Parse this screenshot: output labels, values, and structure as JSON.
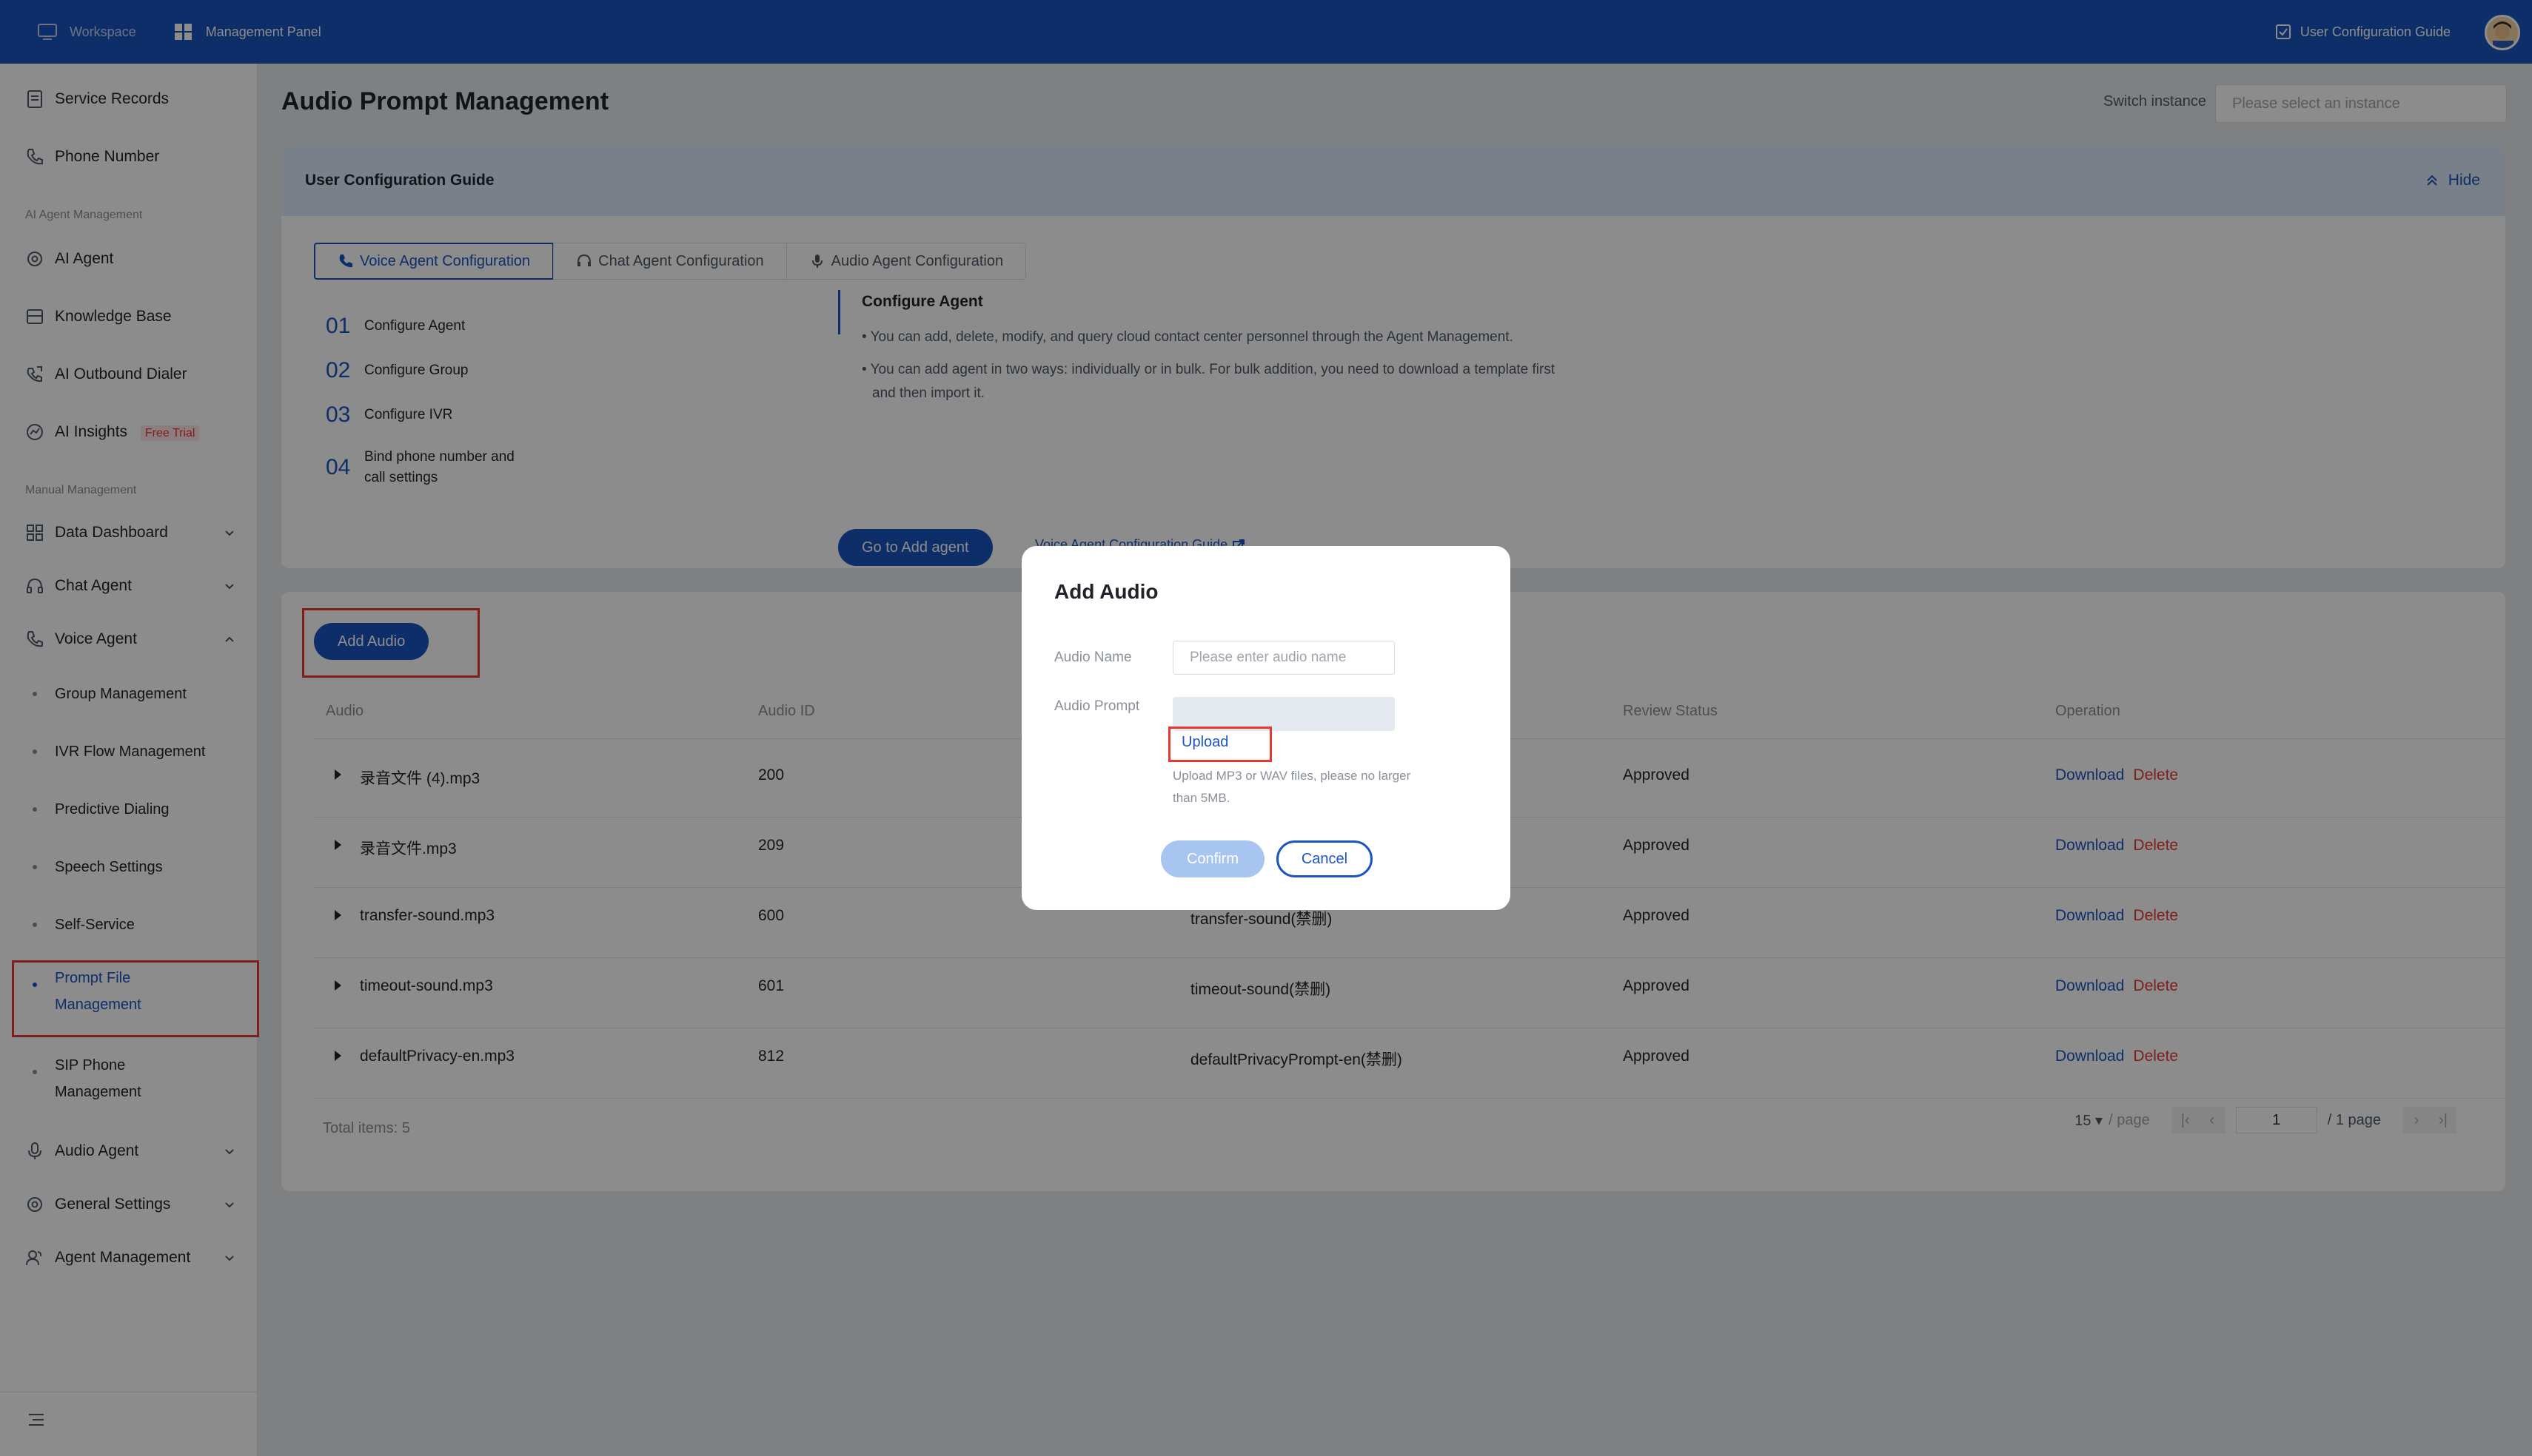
{
  "topbar": {
    "workspace": "Workspace",
    "management_panel": "Management Panel",
    "user_guide": "User Configuration Guide"
  },
  "sidebar": {
    "service_records": "Service Records",
    "phone_number": "Phone Number",
    "section_ai": "AI Agent Management",
    "ai_agent": "AI Agent",
    "knowledge_base": "Knowledge Base",
    "ai_outbound_dialer": "AI Outbound Dialer",
    "ai_insights": "AI Insights",
    "ai_insights_badge": "Free Trial",
    "section_manual": "Manual Management",
    "data_dashboard": "Data Dashboard",
    "chat_agent": "Chat Agent",
    "voice_agent": "Voice Agent",
    "voice_sub": [
      "Group Management",
      "IVR Flow Management",
      "Predictive Dialing",
      "Speech Settings",
      "Self-Service"
    ],
    "prompt_file_mgmt_1": "Prompt File",
    "prompt_file_mgmt_2": "Management",
    "sip_phone_1": "SIP Phone",
    "sip_phone_2": "Management",
    "audio_agent": "Audio Agent",
    "general_settings": "General Settings",
    "agent_management": "Agent Management"
  },
  "main": {
    "title": "Audio Prompt Management",
    "switch_label": "Switch instance",
    "switch_placeholder": "Please select an instance"
  },
  "guide": {
    "title": "User Configuration Guide",
    "hide": "Hide",
    "tabs": [
      "Voice Agent Configuration",
      "Chat Agent Configuration",
      "Audio Agent Configuration"
    ],
    "steps": [
      {
        "num": "01",
        "label": "Configure Agent"
      },
      {
        "num": "02",
        "label": "Configure Group"
      },
      {
        "num": "03",
        "label": "Configure IVR"
      },
      {
        "num": "04",
        "label_1": "Bind phone number and",
        "label_2": "call settings"
      }
    ],
    "section_title": "Configure Agent",
    "line1": "• You can add, delete, modify, and query cloud contact center personnel through the Agent Management.",
    "line2": "• You can add agent in two ways: individually or in bulk. For bulk addition, you need to download a template first",
    "line3": "and then import it.",
    "go_button": "Go to Add agent",
    "guide_link": "Voice Agent Configuration Guide"
  },
  "table": {
    "add_button": "Add Audio",
    "headers": {
      "audio": "Audio",
      "audio_id": "Audio ID",
      "review_status": "Review Status",
      "operation": "Operation"
    },
    "rows": [
      {
        "audio": "录音文件 (4).mp3",
        "id": "200",
        "name": "",
        "status": "Approved"
      },
      {
        "audio": "录音文件.mp3",
        "id": "209",
        "name": "",
        "status": "Approved"
      },
      {
        "audio": "transfer-sound.mp3",
        "id": "600",
        "name": "transfer-sound(禁删)",
        "status": "Approved"
      },
      {
        "audio": "timeout-sound.mp3",
        "id": "601",
        "name": "timeout-sound(禁删)",
        "status": "Approved"
      },
      {
        "audio": "defaultPrivacy-en.mp3",
        "id": "812",
        "name": "defaultPrivacyPrompt-en(禁删)",
        "status": "Approved"
      }
    ],
    "op_download": "Download",
    "op_delete": "Delete",
    "total": "Total items: 5",
    "page_size": "15",
    "per_page": "/ page",
    "page": "1",
    "page_total": "/ 1 page"
  },
  "modal": {
    "title": "Add Audio",
    "audio_name_label": "Audio Name",
    "audio_name_placeholder": "Please enter audio name",
    "audio_prompt_label": "Audio Prompt",
    "upload": "Upload",
    "hint_1": "Upload MP3 or WAV files, please no larger",
    "hint_2": "than 5MB.",
    "confirm": "Confirm",
    "cancel": "Cancel"
  },
  "colors": {
    "brand": "#1a55c2",
    "danger": "#e53935"
  }
}
